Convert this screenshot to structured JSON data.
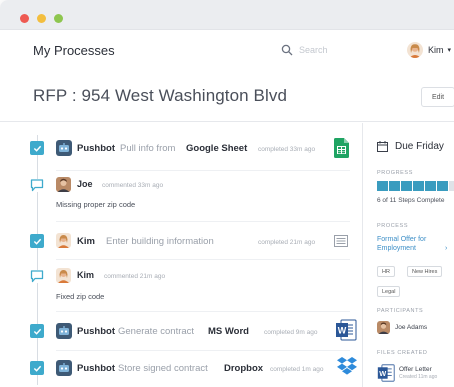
{
  "app": {
    "title": "My Processes"
  },
  "search": {
    "placeholder": "Search"
  },
  "user": {
    "name": "Kim"
  },
  "page": {
    "title": "RFP : 954 West Washington Blvd",
    "edit_label": "Edit"
  },
  "feed": {
    "items": [
      {
        "actor": "Pushbot",
        "text": "Pull info from",
        "target": "Google Sheet",
        "meta": "completed 33m ago"
      },
      {
        "actor": "Joe",
        "meta": "commented 33m ago",
        "comment": "Missing proper zip code"
      },
      {
        "actor": "Kim",
        "text": "Enter building information",
        "meta": "completed 21m ago"
      },
      {
        "actor": "Kim",
        "meta": "commented 21m ago",
        "comment": "Fixed zip code"
      },
      {
        "actor": "Pushbot",
        "text": "Generate contract",
        "target": "MS Word",
        "meta": "completed 9m ago"
      },
      {
        "actor": "Pushbot",
        "text": "Store signed contract",
        "target": "Dropbox",
        "meta": "completed 1m ago"
      }
    ]
  },
  "sidebar": {
    "due": "Due Friday",
    "progress_label": "PROGRESS",
    "progress": {
      "done": 6,
      "total": 11,
      "text": "6 of 11 Steps Complete"
    },
    "process_label": "PROCESS",
    "process_link": "Formal Offer for Employment",
    "tags": [
      "HR",
      "New Hires",
      "Legal"
    ],
    "participants_label": "PARTICIPANTS",
    "participant": "Joe Adams",
    "files_label": "FILES CREATED",
    "file": {
      "name": "Offer Letter",
      "meta": "Created 11m ago"
    }
  },
  "colors": {
    "accent": "#3eaacc",
    "link": "#3d8fc7",
    "progress_fill": "#3a9cbf",
    "progress_empty": "#dfe3e8"
  }
}
